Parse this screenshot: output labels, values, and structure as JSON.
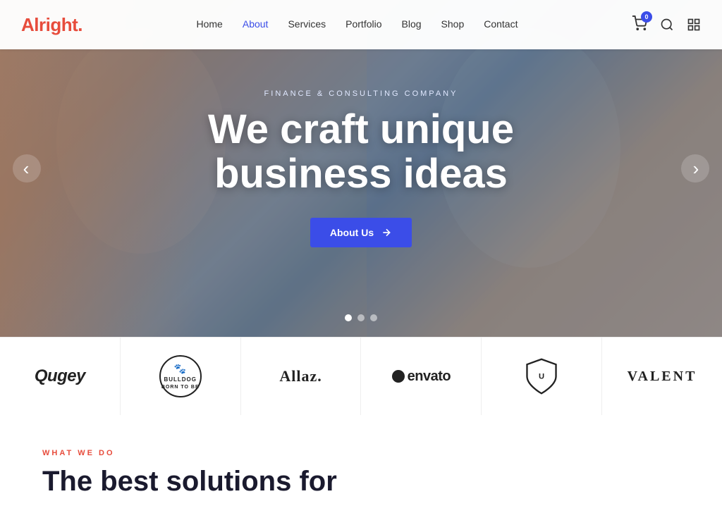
{
  "brand": {
    "name": "Alright",
    "dot": "."
  },
  "navbar": {
    "links": [
      {
        "label": "Home",
        "active": false
      },
      {
        "label": "About",
        "active": true
      },
      {
        "label": "Services",
        "active": false
      },
      {
        "label": "Portfolio",
        "active": false
      },
      {
        "label": "Blog",
        "active": false
      },
      {
        "label": "Shop",
        "active": false
      },
      {
        "label": "Contact",
        "active": false
      }
    ],
    "cart_count": "0"
  },
  "hero": {
    "subtitle": "Finance & Consulting Company",
    "title_line1": "We craft unique",
    "title_line2": "business ideas",
    "cta_label": "About Us",
    "arrow_left": "‹",
    "arrow_right": "›",
    "dots": [
      {
        "active": true
      },
      {
        "active": false
      },
      {
        "active": false
      }
    ]
  },
  "logos": [
    {
      "id": "qugey",
      "text": "Qugey",
      "type": "text",
      "style": "qugey"
    },
    {
      "id": "bulldog",
      "text": "BULLDOG",
      "type": "circle",
      "sub": "BORN TO BE"
    },
    {
      "id": "allaz",
      "text": "Allaz.",
      "type": "text",
      "style": "allaz"
    },
    {
      "id": "envato",
      "text": "●envato",
      "type": "text",
      "style": "envato"
    },
    {
      "id": "shield",
      "text": "",
      "type": "shield"
    },
    {
      "id": "valent",
      "text": "VALENT",
      "type": "text",
      "style": "valent"
    }
  ],
  "bottom": {
    "eyebrow": "WHAT WE DO",
    "title": "The best solutions for"
  }
}
